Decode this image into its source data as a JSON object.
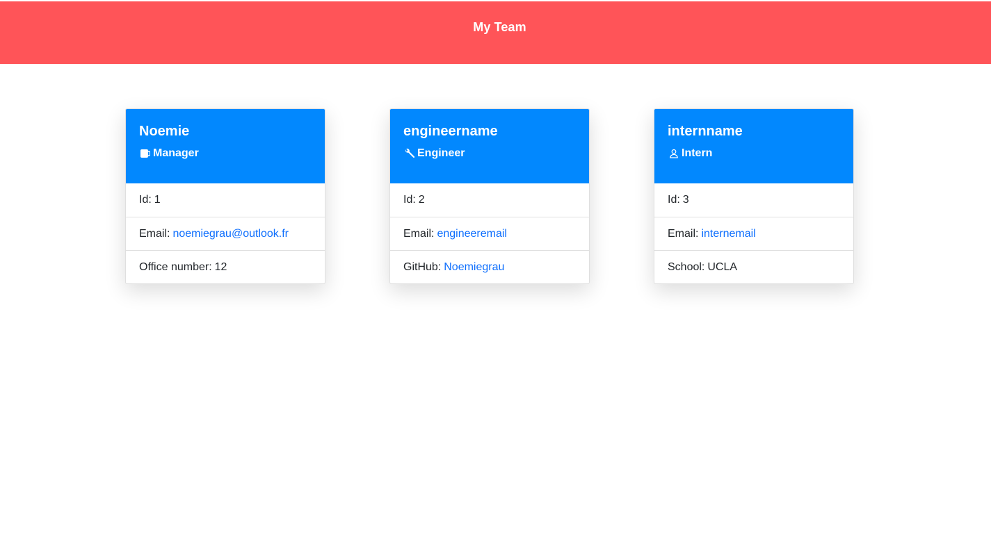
{
  "header": {
    "title": "My Team"
  },
  "cards": [
    {
      "name": "Noemie",
      "role": "Manager",
      "role_icon": "coffee-mug-icon",
      "id_label": "Id:",
      "id_value": "1",
      "email_label": "Email:",
      "email_value": "noemiegrau@outlook.fr",
      "extra_label": "Office number:",
      "extra_value": "12"
    },
    {
      "name": "engineername",
      "role": "Engineer",
      "role_icon": "wrench-icon",
      "id_label": "Id:",
      "id_value": "2",
      "email_label": "Email:",
      "email_value": "engineeremail",
      "extra_label": "GitHub:",
      "extra_value": "Noemiegrau"
    },
    {
      "name": "internname",
      "role": "Intern",
      "role_icon": "person-icon",
      "id_label": "Id:",
      "id_value": "3",
      "email_label": "Email:",
      "email_value": "internemail",
      "extra_label": "School:",
      "extra_value": "UCLA"
    }
  ],
  "colors": {
    "header_bg": "#ff5458",
    "card_header_bg": "#0288fe",
    "link": "#0d6efd"
  }
}
